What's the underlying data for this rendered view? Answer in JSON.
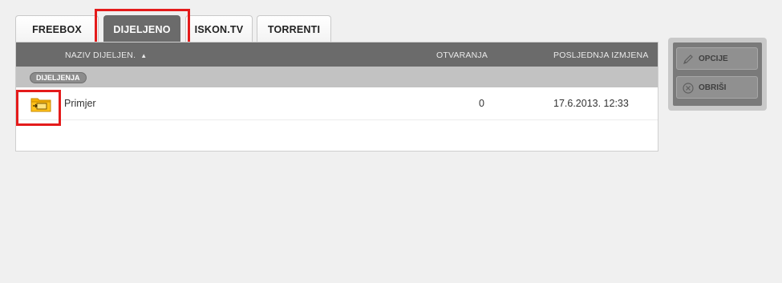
{
  "tabs": [
    {
      "label": "FREEBOX",
      "active": false
    },
    {
      "label": "DIJELJENO",
      "active": true
    },
    {
      "label": "ISKON.TV",
      "active": false
    },
    {
      "label": "TORRENTI",
      "active": false
    }
  ],
  "table": {
    "columns": {
      "name": "NAZIV DIJELJEN.",
      "sort_indicator": "▲",
      "opens": "OTVARANJA",
      "modified": "POSLJEDNJA IZMJENA"
    },
    "group_label": "DIJELJENJA",
    "rows": [
      {
        "icon": "shared-folder-icon",
        "name": "Primjer",
        "opens": "0",
        "modified": "17.6.2013. 12:33"
      }
    ]
  },
  "actions": {
    "options_label": "OPCIJE",
    "delete_label": "OBRIŠI"
  },
  "colors": {
    "active_tab": "#6b6b6b",
    "highlight": "#e41b1b",
    "folder": "#f5b301"
  }
}
